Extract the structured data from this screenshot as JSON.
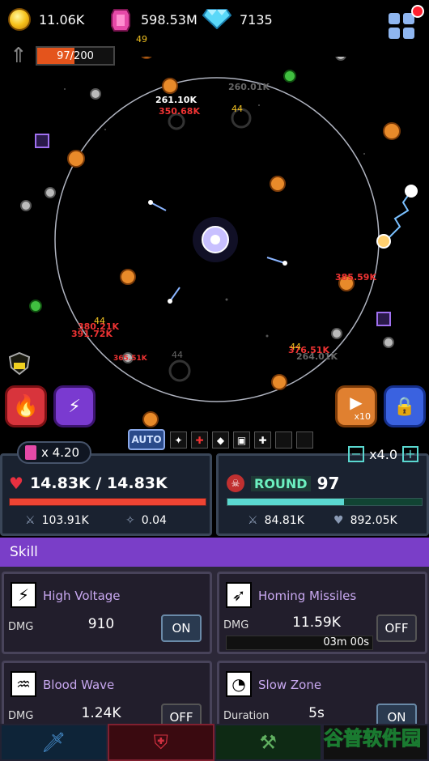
{
  "resources": {
    "gold": "11.06K",
    "gems": "598.53M",
    "diamonds": "7135"
  },
  "upgrade_bar": {
    "text": "97/200",
    "progress": 0.485
  },
  "arena": {
    "damage_numbers": [
      {
        "text": "261.10K",
        "color": "white"
      },
      {
        "text": "350.68K",
        "color": "red"
      },
      {
        "text": "260.01K",
        "color": "grey"
      },
      {
        "text": "385.59K",
        "color": "red"
      },
      {
        "text": "380.21K",
        "color": "red"
      },
      {
        "text": "391.72K",
        "color": "red"
      },
      {
        "text": "376.51K",
        "color": "red"
      },
      {
        "text": "264.01K",
        "color": "grey"
      },
      {
        "text": "365.51K",
        "color": "red"
      }
    ],
    "coin_drops": [
      "49",
      "44",
      "44",
      "44",
      "44"
    ]
  },
  "buttons": {
    "auto": "AUTO",
    "video_multiplier": "x10"
  },
  "left_panel": {
    "gem_multiplier": "x 4.20",
    "hp": "14.83K / 14.83K",
    "hp_fill": 1.0,
    "attack": "103.91K",
    "crit": "0.04"
  },
  "right_panel": {
    "speed": "x4.0",
    "round_label": "ROUND",
    "round_value": "97",
    "round_fill": 0.6,
    "damage": "84.81K",
    "health": "892.05K"
  },
  "skill_section": {
    "title": "Skill"
  },
  "skills": [
    {
      "name": "High Voltage",
      "label": "DMG",
      "value": "910",
      "state": "ON",
      "cooldown": ""
    },
    {
      "name": "Homing Missiles",
      "label": "DMG",
      "value": "11.59K",
      "state": "OFF",
      "cooldown": "03m 00s"
    },
    {
      "name": "Blood Wave",
      "label": "DMG",
      "value": "1.24K",
      "state": "OFF",
      "cooldown": ""
    },
    {
      "name": "Slow Zone",
      "label": "Duration",
      "value": "5s",
      "state": "ON",
      "cooldown": ""
    }
  ],
  "watermark": "谷普软件园",
  "colors": {
    "hp": "#e43",
    "round": "#5ad8d0",
    "skill_header": "#7a3ec8"
  }
}
